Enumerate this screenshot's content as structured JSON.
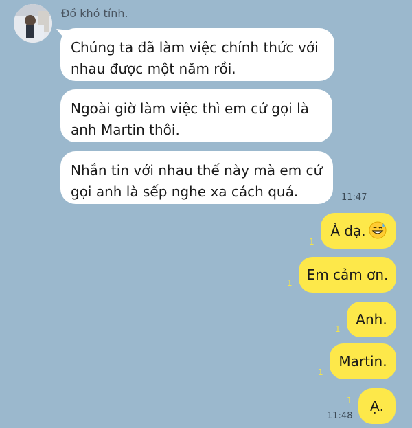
{
  "sender": {
    "name": "Đồ khó tính."
  },
  "incoming": [
    {
      "text": "Chúng ta đã làm việc chính thức với nhau được một năm rồi."
    },
    {
      "text": "Ngoài giờ làm việc thì em cứ gọi là anh Martin thôi."
    },
    {
      "text": "Nhắn tin với nhau thế này mà em cứ gọi anh là sếp nghe xa cách quá."
    }
  ],
  "incoming_time": "11:47",
  "outgoing": [
    {
      "text": "À dạ.",
      "read": "1",
      "emoji": "grinning-sweat-emoji-icon"
    },
    {
      "text": "Em cảm ơn.",
      "read": "1"
    },
    {
      "text": "Anh.",
      "read": "1"
    },
    {
      "text": "Martin.",
      "read": "1"
    },
    {
      "text": "Ạ.",
      "read": "1"
    }
  ],
  "outgoing_time": "11:48",
  "colors": {
    "background": "#9bb8cd",
    "incoming_bubble": "#ffffff",
    "outgoing_bubble": "#fde84a",
    "read_count": "#f4e34a"
  }
}
